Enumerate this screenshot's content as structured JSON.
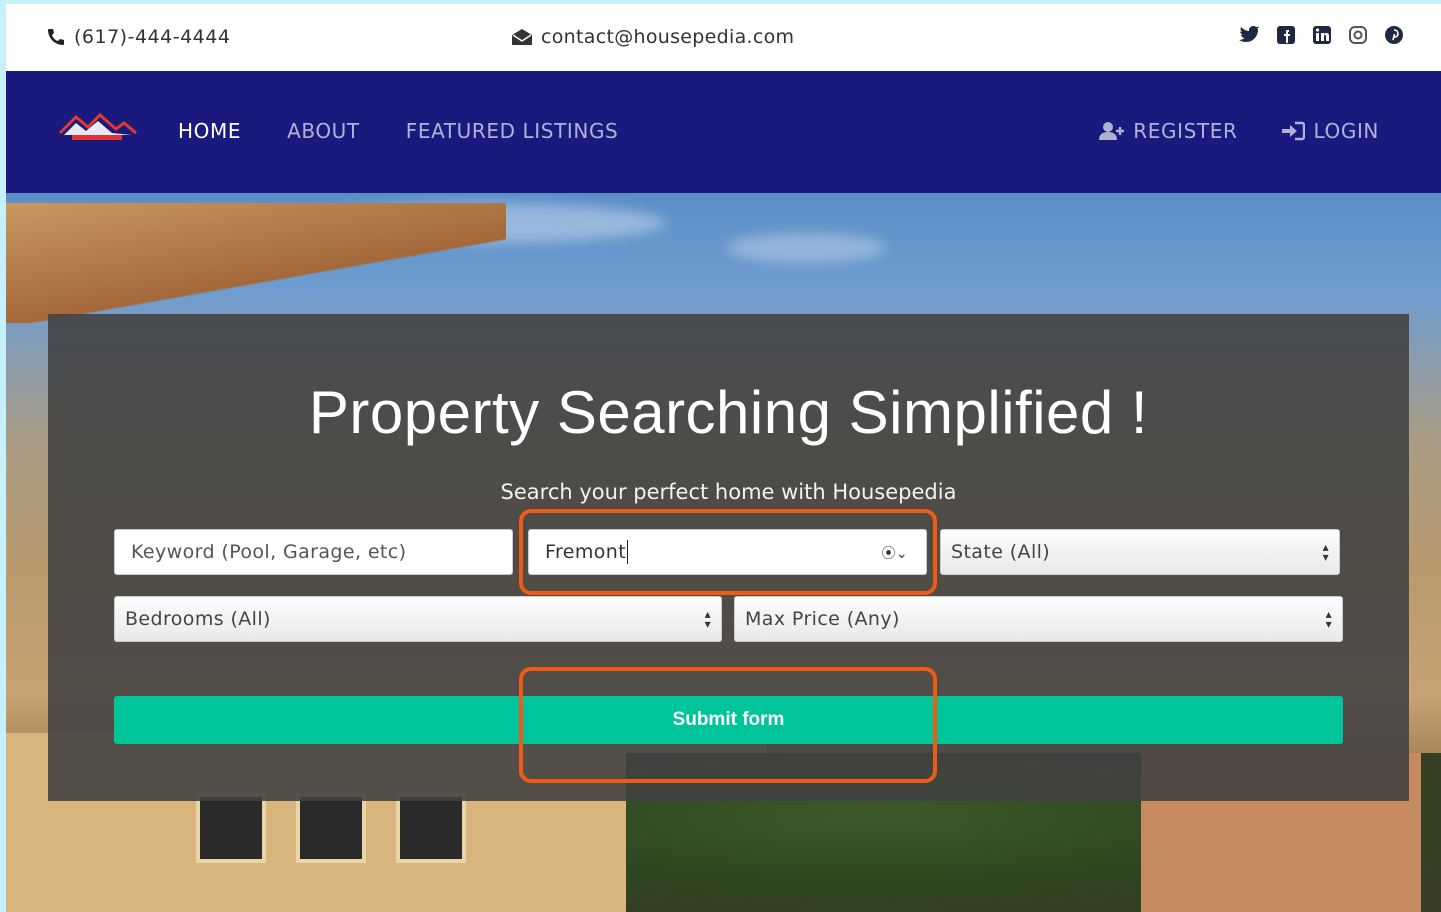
{
  "topbar": {
    "phone": "(617)-444-4444",
    "email": "contact@housepedia.com",
    "social_icons": [
      "twitter-icon",
      "facebook-icon",
      "linkedin-icon",
      "instagram-icon",
      "pinterest-icon"
    ]
  },
  "nav": {
    "logo_text": "Housepedia",
    "items": [
      {
        "label": "HOME",
        "active": true
      },
      {
        "label": "ABOUT",
        "active": false
      },
      {
        "label": "FEATURED LISTINGS",
        "active": false
      }
    ],
    "register": "REGISTER",
    "login": "LOGIN"
  },
  "hero": {
    "title": "Property Searching Simplified !",
    "subtitle": "Search your perfect home with Housepedia"
  },
  "search": {
    "keyword_placeholder": "Keyword (Pool, Garage, etc)",
    "city_value": "Fremont",
    "state_selected": "State (All)",
    "bedrooms_selected": "Bedrooms (All)",
    "max_price_selected": "Max Price (Any)",
    "submit_label": "Submit form"
  },
  "colors": {
    "nav_bg": "#1a1a7e",
    "submit_bg": "#00c59b",
    "highlight": "#ef5a17"
  }
}
